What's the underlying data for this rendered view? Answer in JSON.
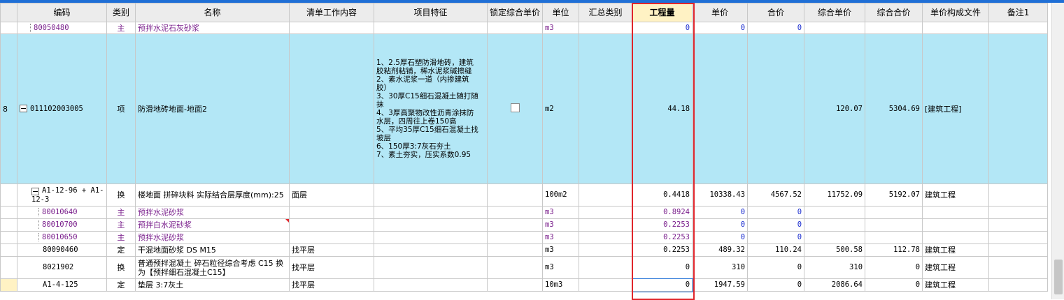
{
  "columns": [
    {
      "key": "idx",
      "label": ""
    },
    {
      "key": "code",
      "label": "编码"
    },
    {
      "key": "type",
      "label": "类别"
    },
    {
      "key": "name",
      "label": "名称"
    },
    {
      "key": "work",
      "label": "清单工作内容"
    },
    {
      "key": "feature",
      "label": "项目特征"
    },
    {
      "key": "lock",
      "label": "锁定综合单价"
    },
    {
      "key": "unit",
      "label": "单位"
    },
    {
      "key": "summary",
      "label": "汇总类别"
    },
    {
      "key": "qty",
      "label": "工程量"
    },
    {
      "key": "price",
      "label": "单价"
    },
    {
      "key": "total",
      "label": "合价"
    },
    {
      "key": "cprice",
      "label": "综合单价"
    },
    {
      "key": "ctotal",
      "label": "综合合价"
    },
    {
      "key": "file",
      "label": "单价构成文件"
    },
    {
      "key": "note",
      "label": "备注1"
    }
  ],
  "rows": [
    {
      "idx": "",
      "code": "80050480",
      "type": "主",
      "name": "预拌水泥石灰砂浆",
      "work": "",
      "feature": "",
      "unit": "m3",
      "summary": "",
      "qty": "0",
      "price": "0",
      "total": "0",
      "cprice": "",
      "ctotal": "",
      "file": "",
      "note": ""
    },
    {
      "idx": "8",
      "code": "011102003005",
      "type": "项",
      "name": "防滑地砖地面-地面2",
      "work": "",
      "feature_lines": [
        "1、2.5厚石塑防滑地砖，建筑",
        "胶粘剂粘铺，稀水泥浆碱擦缝",
        "2、素水泥浆一道（内掺建筑",
        "胶）",
        "3、30厚C15细石混凝土随打随",
        "抹",
        "4、3厚高聚物改性沥青涂抹防",
        "水层，四周往上卷150高",
        "5、平均35厚C15细石混凝土找",
        "坡层",
        "6、150厚3:7灰石夯土",
        "7、素土夯实，压实系数0.95"
      ],
      "unit": "m2",
      "summary": "",
      "qty": "44.18",
      "price": "",
      "total": "",
      "cprice": "120.07",
      "ctotal": "5304.69",
      "file": "[建筑工程]",
      "note": ""
    },
    {
      "idx": "",
      "code": "A1-12-96 + A1-12-3",
      "type": "换",
      "name": "楼地面 拼碎块料  实际结合层厚度(mm):25",
      "work": "面层",
      "feature": "",
      "unit": "100m2",
      "summary": "",
      "qty": "0.4418",
      "price": "10338.43",
      "total": "4567.52",
      "cprice": "11752.09",
      "ctotal": "5192.07",
      "file": "建筑工程",
      "note": ""
    },
    {
      "idx": "",
      "code": "80010640",
      "type": "主",
      "name": "预拌水泥砂浆",
      "work": "",
      "feature": "",
      "unit": "m3",
      "summary": "",
      "qty": "0.8924",
      "price": "0",
      "total": "0",
      "cprice": "",
      "ctotal": "",
      "file": "",
      "note": ""
    },
    {
      "idx": "",
      "code": "80010700",
      "type": "主",
      "name": "预拌白水泥砂浆",
      "work": "",
      "feature": "",
      "unit": "m3",
      "summary": "",
      "qty": "0.2253",
      "price": "0",
      "total": "0",
      "cprice": "",
      "ctotal": "",
      "file": "",
      "note": ""
    },
    {
      "idx": "",
      "code": "80010650",
      "type": "主",
      "name": "预拌水泥砂浆",
      "work": "",
      "feature": "",
      "unit": "m3",
      "summary": "",
      "qty": "0.2253",
      "price": "0",
      "total": "0",
      "cprice": "",
      "ctotal": "",
      "file": "",
      "note": ""
    },
    {
      "idx": "",
      "code": "80090460",
      "type": "定",
      "name": "干混地面砂浆 DS M15",
      "work": "找平层",
      "feature": "",
      "unit": "m3",
      "summary": "",
      "qty": "0.2253",
      "price": "489.32",
      "total": "110.24",
      "cprice": "500.58",
      "ctotal": "112.78",
      "file": "建筑工程",
      "note": ""
    },
    {
      "idx": "",
      "code": "8021902",
      "type": "换",
      "name": "普通预拌混凝土 碎石粒径综合考虑 C15  换为【预拌细石混凝土C15】",
      "work": "找平层",
      "feature": "",
      "unit": "m3",
      "summary": "",
      "qty": "0",
      "price": "310",
      "total": "0",
      "cprice": "310",
      "ctotal": "0",
      "file": "建筑工程",
      "note": ""
    },
    {
      "idx": "",
      "code": "A1-4-125",
      "type": "定",
      "name": "垫层 3:7灰土",
      "work": "找平层",
      "feature": "",
      "unit": "10m3",
      "summary": "",
      "qty": "0",
      "price": "1947.59",
      "total": "0",
      "cprice": "2086.64",
      "ctotal": "0",
      "file": "建筑工程",
      "note": ""
    }
  ],
  "colors": {
    "highlight_box": "#e0252b",
    "selected_row": "#b3e7f6",
    "sub_item_text": "#7a1f8c",
    "zero_value_text": "#1a2ccf"
  }
}
